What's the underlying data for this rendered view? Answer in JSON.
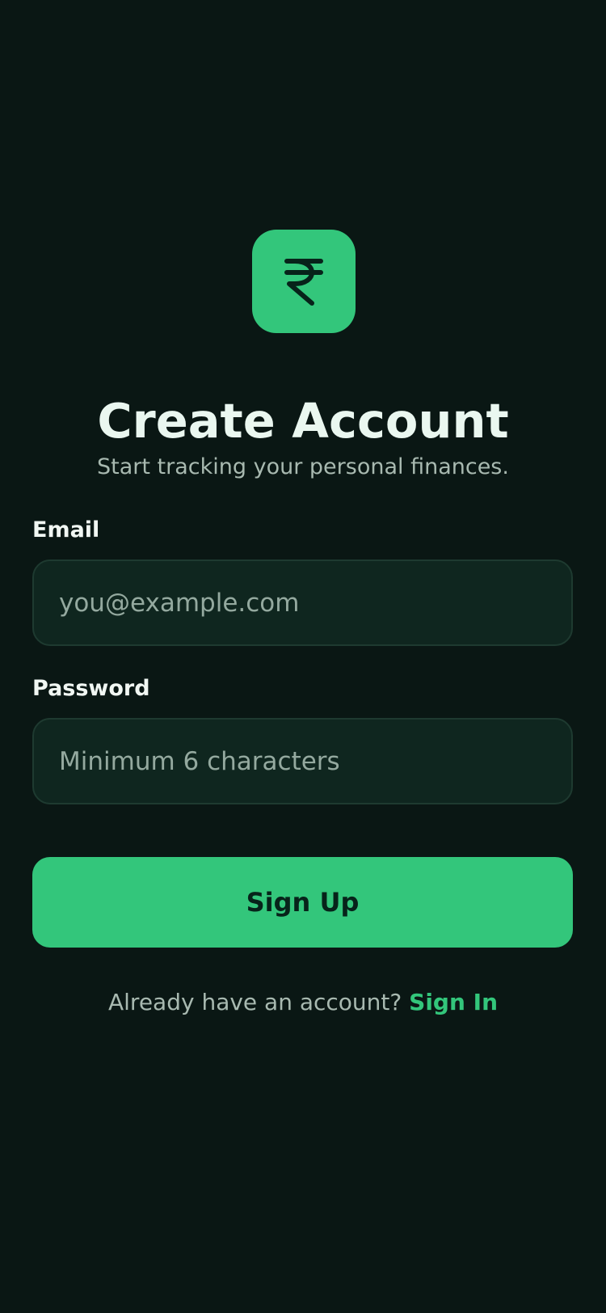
{
  "colors": {
    "background": "#0a1714",
    "accent": "#33c67b",
    "input_background": "#0f261f",
    "input_border": "#1e3a30",
    "title_text": "#eaf7f0",
    "muted_text": "#a8b9b0",
    "button_text": "#07231a"
  },
  "logo": {
    "icon": "rupee-icon"
  },
  "header": {
    "title": "Create Account",
    "subtitle": "Start tracking your personal finances."
  },
  "form": {
    "email": {
      "label": "Email",
      "value": "",
      "placeholder": "you@example.com"
    },
    "password": {
      "label": "Password",
      "value": "",
      "placeholder": "Minimum 6 characters"
    },
    "submit_label": "Sign Up"
  },
  "footer": {
    "prompt": "Already have an account?",
    "link_label": "Sign In"
  }
}
